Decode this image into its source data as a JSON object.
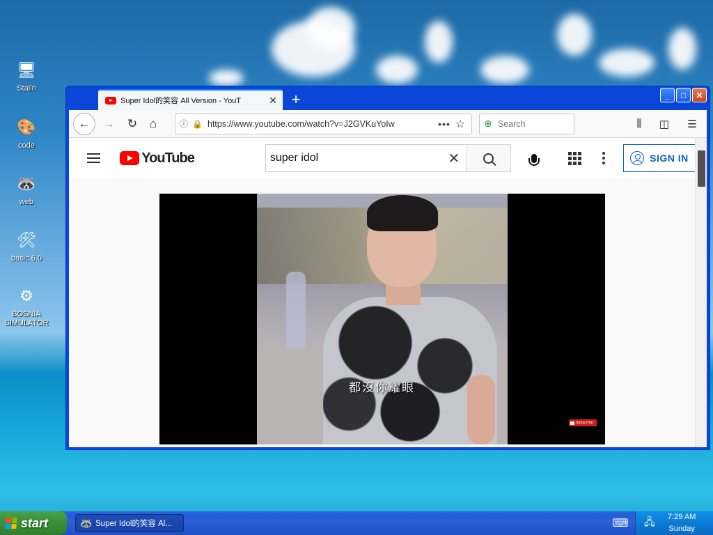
{
  "desktop": {
    "icons": [
      {
        "label": "Stalin",
        "icon": "computer-icon"
      },
      {
        "label": "code",
        "icon": "paint-icon"
      },
      {
        "label": "web",
        "icon": "raccoon-icon"
      },
      {
        "label": "basic 6.0",
        "icon": "vb-icon"
      },
      {
        "label": "BOSNIA\nSIMULATOR",
        "icon": "gear-globe-icon"
      }
    ]
  },
  "browser": {
    "tab_title": "Super Idol的笑容 All Version - YouT",
    "new_tab_symbol": "+",
    "window_controls": {
      "minimize": "_",
      "maximize": "□",
      "close": "✕"
    },
    "url": "https://www.youtube.com/watch?v=J2GVKuYoIw",
    "url_more": "•••",
    "search_placeholder": "Search"
  },
  "youtube": {
    "logo_text": "YouTube",
    "search_query": "super idol",
    "sign_in_label": "SIGN IN",
    "video_subtitle": "都沒你耀眼",
    "subscribe_badge": "Subscribe"
  },
  "taskbar": {
    "start_label": "start",
    "task_item_label": "Super Idol的笑容 Al...",
    "clock_time": "7:29 AM",
    "clock_day": "Sunday"
  },
  "colors": {
    "youtube_red": "#ff0000",
    "sign_in_blue": "#065fd4",
    "xp_window_blue": "#0a46d8",
    "start_green": "#3c8f3c"
  }
}
